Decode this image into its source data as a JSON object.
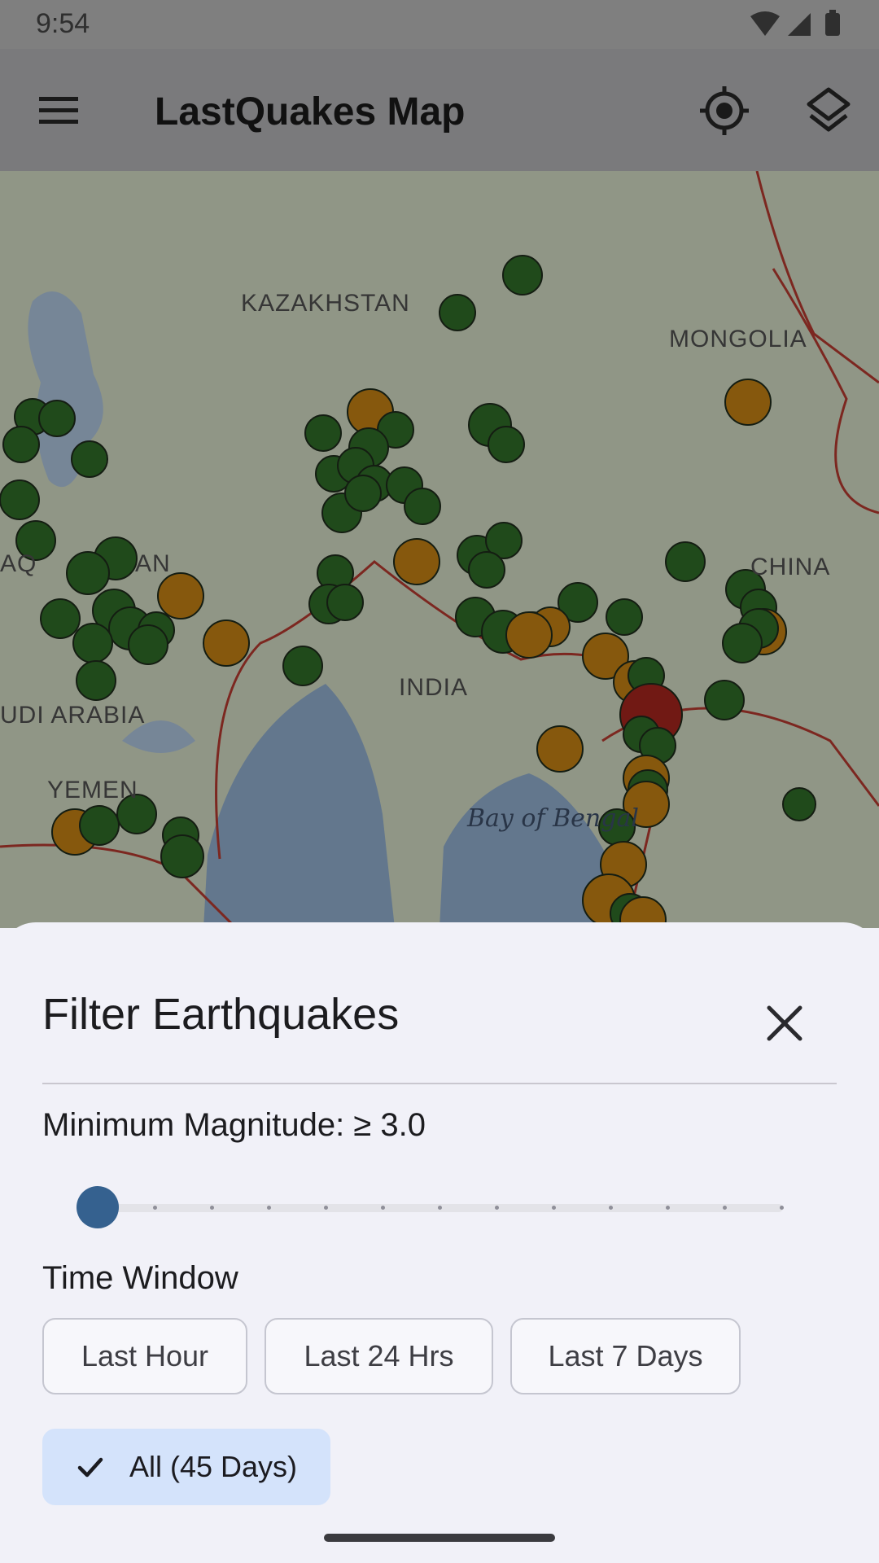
{
  "status_bar": {
    "time": "9:54"
  },
  "app_bar": {
    "title": "LastQuakes Map",
    "menu_icon": "hamburger-menu-icon",
    "locate_icon": "my-location-icon",
    "layers_icon": "layers-icon"
  },
  "map": {
    "labels": {
      "kazakhstan": "KAZAKHSTAN",
      "mongolia": "MONGOLIA",
      "china": "CHINA",
      "india": "INDIA",
      "saudi_arabia": "UDI ARABIA",
      "yemen": "YEMEN",
      "afghanistan": "AN",
      "iraq": "AQ",
      "bay_of_bengal": "Bay of Bengal"
    },
    "colors": {
      "minor_quake": "#2e6b27",
      "moderate_quake": "#c17e14",
      "strong_quake": "#a3241e",
      "plate_boundary": "#b2382e"
    }
  },
  "filter_sheet": {
    "title": "Filter Earthquakes",
    "close_icon": "close-icon",
    "magnitude_label": "Minimum Magnitude: ≥ 3.0",
    "magnitude_slider": {
      "min": 3.0,
      "step_count": 13,
      "value": 3.0
    },
    "time_window_label": "Time Window",
    "time_options": [
      "Last Hour",
      "Last 24 Hrs",
      "Last 7 Days",
      "All (45 Days)"
    ],
    "selected_time_option": "All (45 Days)",
    "accent_color": "#35618f",
    "selected_chip_color": "#d4e3fb"
  }
}
